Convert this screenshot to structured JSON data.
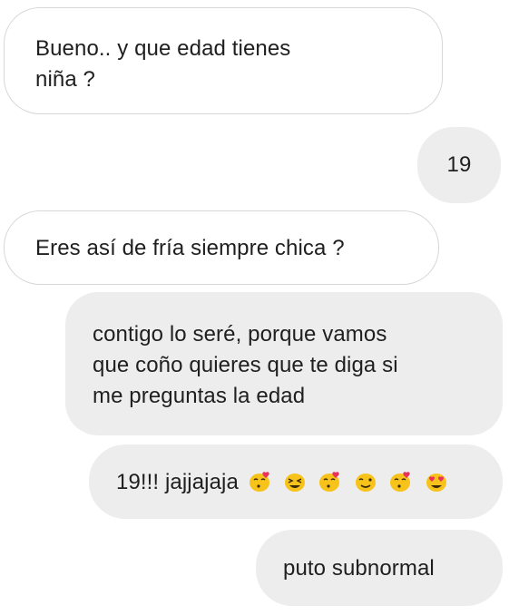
{
  "conversation": {
    "messages": [
      {
        "direction": "incoming",
        "text": "Bueno.. y que edad tienes",
        "text2": "niña ?"
      },
      {
        "direction": "outgoing",
        "text": "19"
      },
      {
        "direction": "incoming",
        "text": "Eres así de fría siempre chica ?"
      },
      {
        "direction": "outgoing",
        "line1": "contigo lo seré, porque vamos",
        "line2": "que coño quieres que te diga si",
        "line3": "me preguntas la edad"
      },
      {
        "direction": "outgoing",
        "text": "19!!! jajjajaja",
        "emojis": [
          "blowing-kiss-emoji",
          "grinning-squint-emoji",
          "blowing-kiss-emoji",
          "winking-emoji",
          "blowing-kiss-emoji",
          "heart-eyes-emoji"
        ]
      },
      {
        "direction": "outgoing",
        "text": "puto subnormal"
      }
    ]
  },
  "colors": {
    "incoming_bg": "#ffffff",
    "incoming_border": "#d7d7d7",
    "outgoing_bg": "#ededed",
    "text": "#1f1f1f",
    "emoji_yellow": "#f7c31b",
    "emoji_heart": "#e8325a"
  }
}
